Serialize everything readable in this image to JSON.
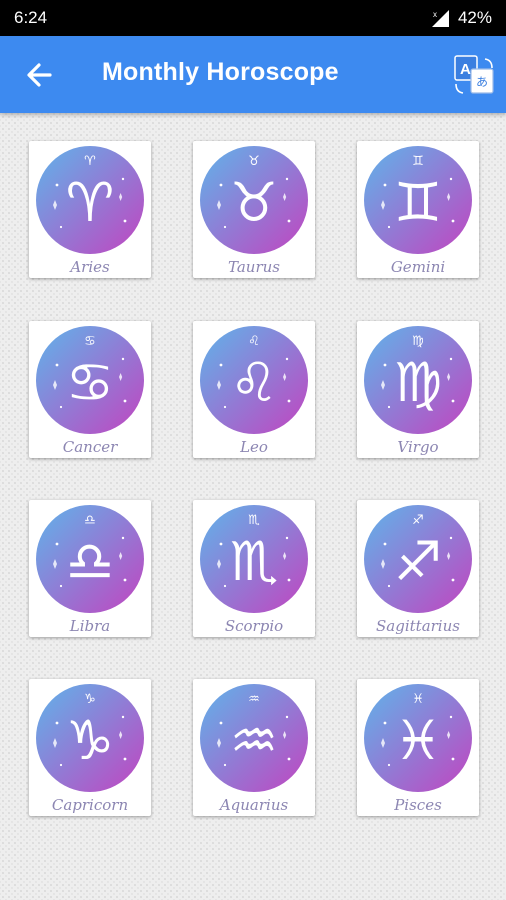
{
  "status_bar": {
    "time": "6:24",
    "battery": "42%"
  },
  "app_bar": {
    "title": "Monthly Horoscope",
    "back_icon": "arrow-back-icon",
    "translate_icon": "translate-icon"
  },
  "colors": {
    "app_bar": "#3d8af0",
    "medallion_start": "#5fb4ea",
    "medallion_end": "#c244c0",
    "label": "#8c86b2"
  },
  "signs": [
    {
      "label": "Aries",
      "glyph": "♈"
    },
    {
      "label": "Taurus",
      "glyph": "♉"
    },
    {
      "label": "Gemini",
      "glyph": "♊"
    },
    {
      "label": "Cancer",
      "glyph": "♋"
    },
    {
      "label": "Leo",
      "glyph": "♌"
    },
    {
      "label": "Virgo",
      "glyph": "♍"
    },
    {
      "label": "Libra",
      "glyph": "♎"
    },
    {
      "label": "Scorpio",
      "glyph": "♏"
    },
    {
      "label": "Sagittarius",
      "glyph": "♐"
    },
    {
      "label": "Capricorn",
      "glyph": "♑"
    },
    {
      "label": "Aquarius",
      "glyph": "♒"
    },
    {
      "label": "Pisces",
      "glyph": "♓"
    }
  ]
}
